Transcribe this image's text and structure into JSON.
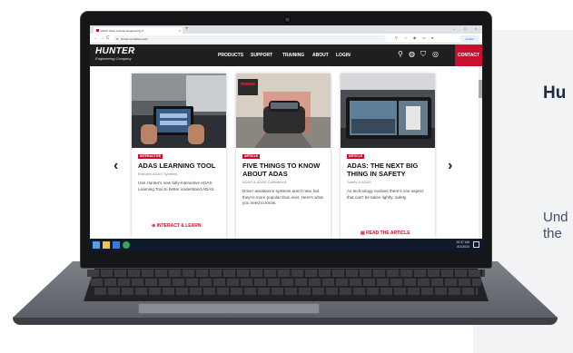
{
  "background": {
    "title": "Hu",
    "lines": [
      "Und",
      "the"
    ]
  },
  "browser": {
    "tab_title": "ADAS Tools | Hunter Engineering C",
    "tab_close": "×",
    "new_tab": "+",
    "window_controls": [
      "–",
      "□",
      "×"
    ],
    "nav": [
      "←",
      "→",
      "C"
    ],
    "url": "hunter.com/adas-tools",
    "update_label": "Update"
  },
  "site": {
    "logo": "HUNTER",
    "logo_sub": "Engineering Company",
    "nav": [
      "PRODUCTS",
      "SUPPORT",
      "TRAINING",
      "ABOUT",
      "LOGIN"
    ],
    "contact": "CONTACT",
    "colors": {
      "brand_red": "#c8102e",
      "header_bg": "#1f1f1f"
    }
  },
  "carousel": {
    "prev": "‹",
    "next": "›",
    "cards": [
      {
        "badge": "INTERACTIVE",
        "title": "ADAS LEARNING TOOL",
        "subtitle": "Branded ADAS Systems",
        "description": "Use Hunter's new fully-interactive ADAS Learning Tool to better understand ADAS.",
        "cta": "⊕ INTERACT & LEARN"
      },
      {
        "badge": "ARTICLE",
        "title": "FIVE THINGS TO KNOW ABOUT ADAS",
        "subtitle": "ADAS & ADAS Calibrations",
        "description": "Driver assistance systems aren't new, but they're more popular than ever. Here's what you need to know.",
        "cta": ""
      },
      {
        "badge": "ARTICLE",
        "title": "ADAS: THE NEXT BIG THING IN SAFETY",
        "subtitle": "Safety & ADAS",
        "description": "As technology evolves there's one aspect that can't be taken lightly: safety.",
        "cta": "▤ READ THE ARTICLE"
      }
    ]
  },
  "taskbar": {
    "time": "10:37 AM",
    "date": "8/1/2024"
  }
}
